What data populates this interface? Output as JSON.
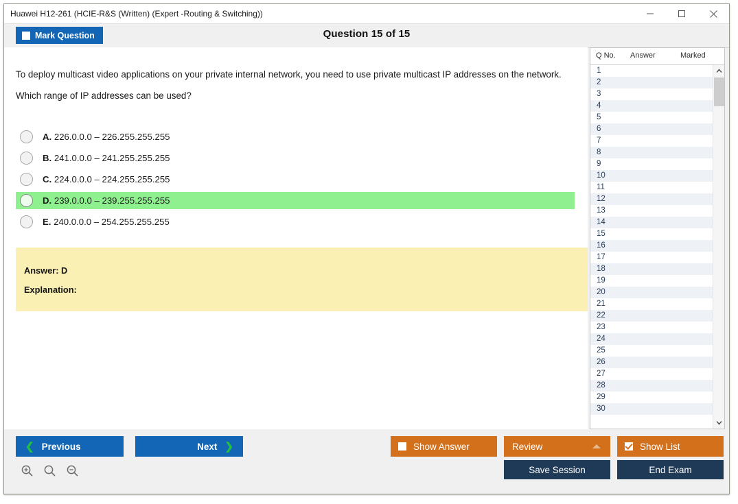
{
  "window": {
    "title": "Huawei H12-261 (HCIE-R&S (Written) (Expert -Routing & Switching))",
    "controls": {
      "minimize": "minimize-icon",
      "maximize": "maximize-icon",
      "close": "close-icon"
    }
  },
  "header": {
    "mark_question_label": "Mark Question",
    "mark_question_checked": false,
    "question_counter": "Question 15 of 15"
  },
  "question": {
    "stem_line1": "To deploy multicast video applications on your private internal network, you need to use private multicast IP addresses on the network.",
    "stem_line2": "Which range of IP addresses can be used?",
    "options": [
      {
        "letter": "A.",
        "text": "226.0.0.0 – 226.255.255.255",
        "selected": false
      },
      {
        "letter": "B.",
        "text": "241.0.0.0 – 241.255.255.255",
        "selected": false
      },
      {
        "letter": "C.",
        "text": "224.0.0.0 – 224.255.255.255",
        "selected": false
      },
      {
        "letter": "D.",
        "text": "239.0.0.0 – 239.255.255.255",
        "selected": true
      },
      {
        "letter": "E.",
        "text": "240.0.0.0 – 254.255.255.255",
        "selected": false
      }
    ],
    "answer_label": "Answer: D",
    "explanation_label": "Explanation:"
  },
  "question_list": {
    "columns": [
      "Q No.",
      "Answer",
      "Marked"
    ],
    "rows": [
      {
        "no": "1",
        "answer": "",
        "marked": ""
      },
      {
        "no": "2",
        "answer": "",
        "marked": ""
      },
      {
        "no": "3",
        "answer": "",
        "marked": ""
      },
      {
        "no": "4",
        "answer": "",
        "marked": ""
      },
      {
        "no": "5",
        "answer": "",
        "marked": ""
      },
      {
        "no": "6",
        "answer": "",
        "marked": ""
      },
      {
        "no": "7",
        "answer": "",
        "marked": ""
      },
      {
        "no": "8",
        "answer": "",
        "marked": ""
      },
      {
        "no": "9",
        "answer": "",
        "marked": ""
      },
      {
        "no": "10",
        "answer": "",
        "marked": ""
      },
      {
        "no": "11",
        "answer": "",
        "marked": ""
      },
      {
        "no": "12",
        "answer": "",
        "marked": ""
      },
      {
        "no": "13",
        "answer": "",
        "marked": ""
      },
      {
        "no": "14",
        "answer": "",
        "marked": ""
      },
      {
        "no": "15",
        "answer": "",
        "marked": ""
      },
      {
        "no": "16",
        "answer": "",
        "marked": ""
      },
      {
        "no": "17",
        "answer": "",
        "marked": ""
      },
      {
        "no": "18",
        "answer": "",
        "marked": ""
      },
      {
        "no": "19",
        "answer": "",
        "marked": ""
      },
      {
        "no": "20",
        "answer": "",
        "marked": ""
      },
      {
        "no": "21",
        "answer": "",
        "marked": ""
      },
      {
        "no": "22",
        "answer": "",
        "marked": ""
      },
      {
        "no": "23",
        "answer": "",
        "marked": ""
      },
      {
        "no": "24",
        "answer": "",
        "marked": ""
      },
      {
        "no": "25",
        "answer": "",
        "marked": ""
      },
      {
        "no": "26",
        "answer": "",
        "marked": ""
      },
      {
        "no": "27",
        "answer": "",
        "marked": ""
      },
      {
        "no": "28",
        "answer": "",
        "marked": ""
      },
      {
        "no": "29",
        "answer": "",
        "marked": ""
      },
      {
        "no": "30",
        "answer": "",
        "marked": ""
      }
    ]
  },
  "toolbar": {
    "previous_label": "Previous",
    "next_label": "Next",
    "show_answer_label": "Show Answer",
    "show_answer_checked": false,
    "review_label": "Review",
    "show_list_label": "Show List",
    "show_list_checked": true,
    "save_session_label": "Save Session",
    "end_exam_label": "End Exam",
    "zoom_in_icon": "zoom-in-icon",
    "zoom_reset_icon": "zoom-reset-icon",
    "zoom_out_icon": "zoom-out-icon"
  },
  "colors": {
    "accent_blue": "#1266b5",
    "accent_orange": "#d2701c",
    "navy": "#1e3a56",
    "selected_green": "#8ff08f",
    "answer_yellow": "#faf0b4"
  }
}
